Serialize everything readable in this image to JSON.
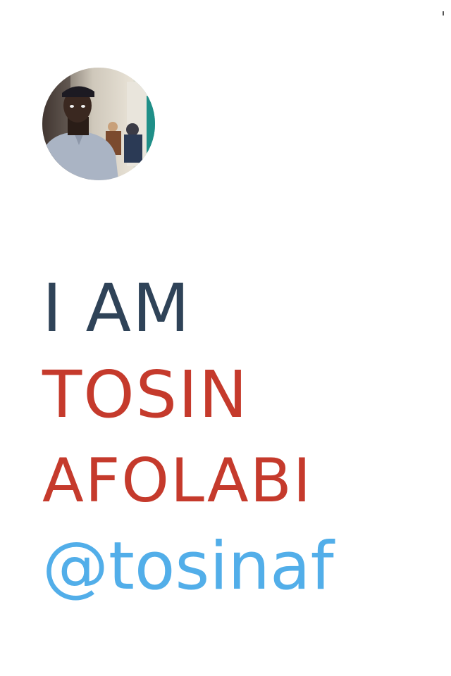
{
  "profile": {
    "avatar_icon": "person-photo-avatar"
  },
  "headline": {
    "intro": "I AM",
    "first_name": "TOSIN",
    "last_name": "AFOLABI",
    "handle": "@tosinaf"
  },
  "colors": {
    "intro": "#2f4358",
    "name": "#c53a2c",
    "handle": "#52aee9",
    "background": "#ffffff"
  }
}
